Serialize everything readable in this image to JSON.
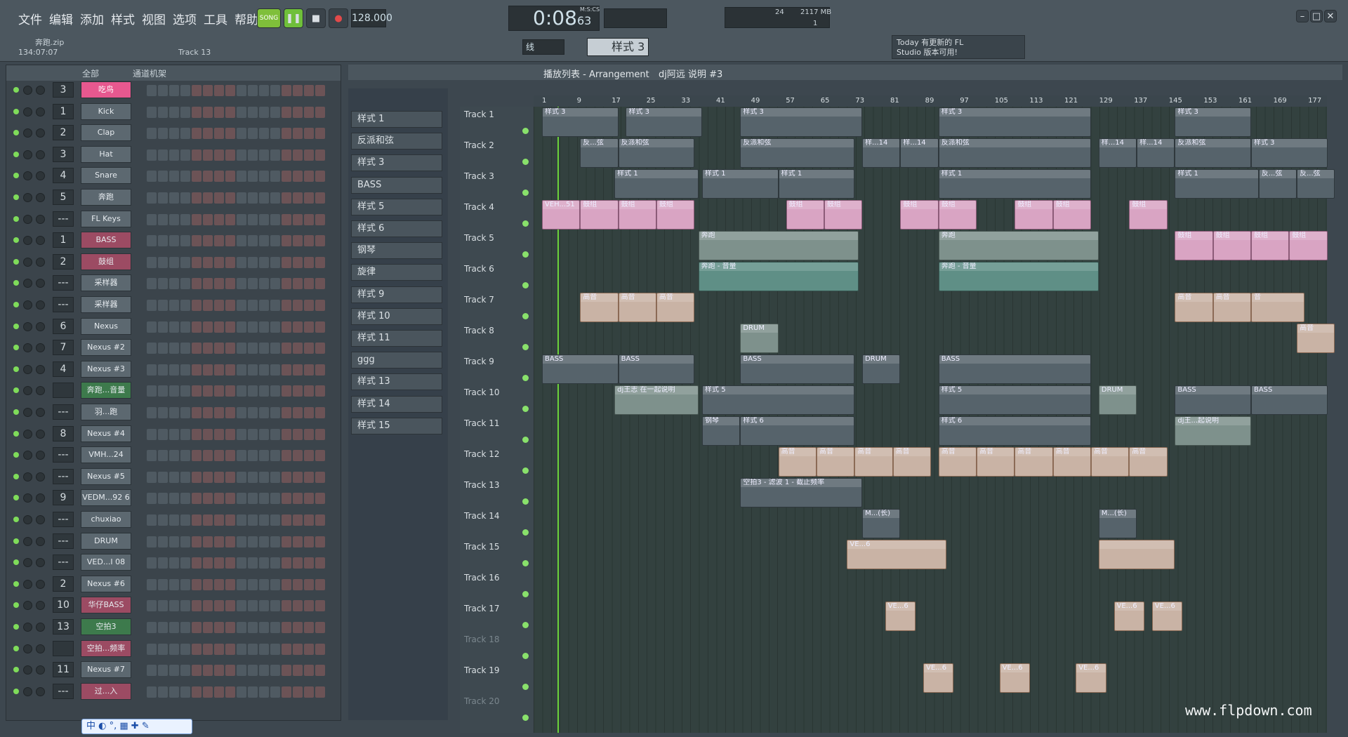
{
  "menu": [
    "文件",
    "编辑",
    "添加",
    "样式",
    "视图",
    "选项",
    "工具",
    "帮助"
  ],
  "transport": {
    "song_label": "SONG",
    "tempo": "128.000",
    "time": "0:08",
    "time_sub": "63",
    "time_unit": "M:S:CS",
    "cpu": "24",
    "memory": "2117 MB",
    "memory_sub": "1"
  },
  "project": {
    "file": "奔跑.zip",
    "position": "134:07:07",
    "track_hint": "Track 13"
  },
  "snap": {
    "mode": "线",
    "pattern": "样式 3"
  },
  "hint": {
    "line1": "Today 有更新的 FL",
    "line2": "Studio 版本可用!"
  },
  "rack": {
    "group": "全部",
    "title": "通道机架",
    "channels": [
      {
        "num": "3",
        "name": "吃鸟",
        "style": "pink"
      },
      {
        "num": "1",
        "name": "Kick",
        "style": ""
      },
      {
        "num": "2",
        "name": "Clap",
        "style": ""
      },
      {
        "num": "3",
        "name": "Hat",
        "style": ""
      },
      {
        "num": "4",
        "name": "Snare",
        "style": ""
      },
      {
        "num": "5",
        "name": "奔跑",
        "style": ""
      },
      {
        "num": "---",
        "name": "FL Keys",
        "style": ""
      },
      {
        "num": "1",
        "name": "BASS",
        "style": "dpink"
      },
      {
        "num": "2",
        "name": "鼓组",
        "style": "dpink"
      },
      {
        "num": "---",
        "name": "采样器",
        "style": ""
      },
      {
        "num": "---",
        "name": "采样器",
        "style": ""
      },
      {
        "num": "6",
        "name": "Nexus",
        "style": ""
      },
      {
        "num": "7",
        "name": "Nexus #2",
        "style": ""
      },
      {
        "num": "4",
        "name": "Nexus #3",
        "style": ""
      },
      {
        "num": "",
        "name": "奔跑...音量",
        "style": "green"
      },
      {
        "num": "---",
        "name": "羽...跑",
        "style": ""
      },
      {
        "num": "8",
        "name": "Nexus #4",
        "style": ""
      },
      {
        "num": "---",
        "name": "VMH...24",
        "style": ""
      },
      {
        "num": "---",
        "name": "Nexus #5",
        "style": ""
      },
      {
        "num": "9",
        "name": "VEDM...92 6",
        "style": ""
      },
      {
        "num": "---",
        "name": "chuxiao",
        "style": ""
      },
      {
        "num": "---",
        "name": "DRUM",
        "style": ""
      },
      {
        "num": "---",
        "name": "VED...I 08",
        "style": ""
      },
      {
        "num": "2",
        "name": "Nexus #6",
        "style": ""
      },
      {
        "num": "10",
        "name": "华仔BASS",
        "style": "dpink"
      },
      {
        "num": "13",
        "name": "空拍3",
        "style": "green"
      },
      {
        "num": "",
        "name": "空拍...频率",
        "style": "dpink"
      },
      {
        "num": "11",
        "name": "Nexus #7",
        "style": ""
      },
      {
        "num": "---",
        "name": "过...入",
        "style": "dpink"
      }
    ]
  },
  "patterns": [
    "样式 1",
    "反派和弦",
    "样式 3",
    "BASS",
    "样式 5",
    "样式 6",
    "钢琴",
    "旋律",
    "样式 9",
    "样式 10",
    "样式 11",
    "ggg",
    "样式 13",
    "样式 14",
    "样式 15"
  ],
  "playlist": {
    "title": "播放列表 - Arrangement",
    "crumb": "dj阿远 说明 #3",
    "ruler": [
      "1",
      "9",
      "17",
      "25",
      "33",
      "41",
      "49",
      "57",
      "65",
      "73",
      "81",
      "89",
      "97",
      "105",
      "113",
      "121",
      "129",
      "137",
      "145",
      "153",
      "161",
      "169",
      "177"
    ],
    "tracks": [
      "Track 1",
      "Track 2",
      "Track 3",
      "Track 4",
      "Track 5",
      "Track 6",
      "Track 7",
      "Track 8",
      "Track 9",
      "Track 10",
      "Track 11",
      "Track 12",
      "Track 13",
      "Track 14",
      "Track 15",
      "Track 16",
      "Track 17",
      "Track 18",
      "Track 19",
      "Track 20"
    ],
    "clips": [
      {
        "t": 0,
        "s": 0,
        "l": 20,
        "label": "样式 3",
        "c": "cg"
      },
      {
        "t": 0,
        "s": 22,
        "l": 20,
        "label": "样式 3",
        "c": "cg"
      },
      {
        "t": 0,
        "s": 52,
        "l": 32,
        "label": "样式 3",
        "c": "cg"
      },
      {
        "t": 0,
        "s": 104,
        "l": 40,
        "label": "样式 3",
        "c": "cg"
      },
      {
        "t": 0,
        "s": 166,
        "l": 20,
        "label": "样式 3",
        "c": "cg"
      },
      {
        "t": 1,
        "s": 10,
        "l": 10,
        "label": "反...弦",
        "c": "cg"
      },
      {
        "t": 1,
        "s": 20,
        "l": 20,
        "label": "反派和弦",
        "c": "cg"
      },
      {
        "t": 1,
        "s": 52,
        "l": 30,
        "label": "反派和弦",
        "c": "cg"
      },
      {
        "t": 1,
        "s": 84,
        "l": 10,
        "label": "样...14",
        "c": "cg"
      },
      {
        "t": 1,
        "s": 94,
        "l": 10,
        "label": "样...14",
        "c": "cg"
      },
      {
        "t": 1,
        "s": 104,
        "l": 40,
        "label": "反派和弦",
        "c": "cg"
      },
      {
        "t": 1,
        "s": 146,
        "l": 10,
        "label": "样...14",
        "c": "cg"
      },
      {
        "t": 1,
        "s": 156,
        "l": 10,
        "label": "样...14",
        "c": "cg"
      },
      {
        "t": 1,
        "s": 166,
        "l": 20,
        "label": "反派和弦",
        "c": "cg"
      },
      {
        "t": 1,
        "s": 186,
        "l": 20,
        "label": "样式 3",
        "c": "cg"
      },
      {
        "t": 2,
        "s": 19,
        "l": 22,
        "label": "样式 1",
        "c": "cg"
      },
      {
        "t": 2,
        "s": 42,
        "l": 20,
        "label": "样式 1",
        "c": "cg"
      },
      {
        "t": 2,
        "s": 62,
        "l": 20,
        "label": "样式 1",
        "c": "cg"
      },
      {
        "t": 2,
        "s": 104,
        "l": 40,
        "label": "样式 1",
        "c": "cg"
      },
      {
        "t": 2,
        "s": 166,
        "l": 22,
        "label": "样式 1",
        "c": "cg"
      },
      {
        "t": 2,
        "s": 188,
        "l": 10,
        "label": "反...弦",
        "c": "cg"
      },
      {
        "t": 2,
        "s": 198,
        "l": 10,
        "label": "反...弦",
        "c": "cg"
      },
      {
        "t": 3,
        "s": 0,
        "l": 10,
        "label": "VEH...51",
        "c": "cp"
      },
      {
        "t": 3,
        "s": 10,
        "l": 10,
        "label": "鼓组",
        "c": "cp"
      },
      {
        "t": 3,
        "s": 20,
        "l": 10,
        "label": "鼓组",
        "c": "cp"
      },
      {
        "t": 3,
        "s": 30,
        "l": 10,
        "label": "鼓组",
        "c": "cp"
      },
      {
        "t": 3,
        "s": 64,
        "l": 10,
        "label": "鼓组",
        "c": "cp"
      },
      {
        "t": 3,
        "s": 74,
        "l": 10,
        "label": "鼓组",
        "c": "cp"
      },
      {
        "t": 3,
        "s": 94,
        "l": 10,
        "label": "鼓组",
        "c": "cp"
      },
      {
        "t": 3,
        "s": 104,
        "l": 10,
        "label": "鼓组",
        "c": "cp"
      },
      {
        "t": 3,
        "s": 124,
        "l": 10,
        "label": "鼓组",
        "c": "cp"
      },
      {
        "t": 3,
        "s": 134,
        "l": 10,
        "label": "鼓组",
        "c": "cp"
      },
      {
        "t": 3,
        "s": 154,
        "l": 10,
        "label": "鼓组",
        "c": "cp"
      },
      {
        "t": 4,
        "s": 41,
        "l": 42,
        "label": "奔跑",
        "c": "cv"
      },
      {
        "t": 4,
        "s": 104,
        "l": 42,
        "label": "奔跑",
        "c": "cv"
      },
      {
        "t": 4,
        "s": 166,
        "l": 10,
        "label": "鼓组",
        "c": "cp"
      },
      {
        "t": 4,
        "s": 176,
        "l": 10,
        "label": "鼓组",
        "c": "cp"
      },
      {
        "t": 4,
        "s": 186,
        "l": 10,
        "label": "鼓组",
        "c": "cp"
      },
      {
        "t": 4,
        "s": 196,
        "l": 10,
        "label": "鼓组",
        "c": "cp"
      },
      {
        "t": 5,
        "s": 41,
        "l": 42,
        "label": "奔跑 - 音量",
        "c": "ct"
      },
      {
        "t": 5,
        "s": 104,
        "l": 42,
        "label": "奔跑 - 音量",
        "c": "ct"
      },
      {
        "t": 6,
        "s": 10,
        "l": 10,
        "label": "高音",
        "c": "co"
      },
      {
        "t": 6,
        "s": 20,
        "l": 10,
        "label": "高音",
        "c": "co"
      },
      {
        "t": 6,
        "s": 30,
        "l": 10,
        "label": "高音",
        "c": "co"
      },
      {
        "t": 6,
        "s": 166,
        "l": 10,
        "label": "高音",
        "c": "co"
      },
      {
        "t": 6,
        "s": 176,
        "l": 10,
        "label": "高音",
        "c": "co"
      },
      {
        "t": 6,
        "s": 186,
        "l": 14,
        "label": "音",
        "c": "co"
      },
      {
        "t": 7,
        "s": 52,
        "l": 10,
        "label": "DRUM",
        "c": "cv"
      },
      {
        "t": 7,
        "s": 198,
        "l": 10,
        "label": "高音",
        "c": "co"
      },
      {
        "t": 8,
        "s": 0,
        "l": 20,
        "label": "BASS",
        "c": "cg"
      },
      {
        "t": 8,
        "s": 20,
        "l": 20,
        "label": "BASS",
        "c": "cg"
      },
      {
        "t": 8,
        "s": 52,
        "l": 30,
        "label": "BASS",
        "c": "cg"
      },
      {
        "t": 8,
        "s": 84,
        "l": 10,
        "label": "DRUM",
        "c": "cg"
      },
      {
        "t": 8,
        "s": 104,
        "l": 40,
        "label": "BASS",
        "c": "cg"
      },
      {
        "t": 9,
        "s": 19,
        "l": 22,
        "label": "dj王志 在一起说明",
        "c": "cv"
      },
      {
        "t": 9,
        "s": 42,
        "l": 40,
        "label": "样式 5",
        "c": "cg"
      },
      {
        "t": 9,
        "s": 104,
        "l": 40,
        "label": "样式 5",
        "c": "cg"
      },
      {
        "t": 9,
        "s": 146,
        "l": 10,
        "label": "DRUM",
        "c": "cv"
      },
      {
        "t": 9,
        "s": 166,
        "l": 20,
        "label": "BASS",
        "c": "cg"
      },
      {
        "t": 9,
        "s": 186,
        "l": 20,
        "label": "BASS",
        "c": "cg"
      },
      {
        "t": 10,
        "s": 42,
        "l": 10,
        "label": "钢琴",
        "c": "cg"
      },
      {
        "t": 10,
        "s": 52,
        "l": 30,
        "label": "样式 6",
        "c": "cg"
      },
      {
        "t": 10,
        "s": 104,
        "l": 40,
        "label": "样式 6",
        "c": "cg"
      },
      {
        "t": 10,
        "s": 166,
        "l": 20,
        "label": "dj王...起说明",
        "c": "cv"
      },
      {
        "t": 11,
        "s": 62,
        "l": 10,
        "label": "高音",
        "c": "co"
      },
      {
        "t": 11,
        "s": 72,
        "l": 10,
        "label": "高音",
        "c": "co"
      },
      {
        "t": 11,
        "s": 82,
        "l": 10,
        "label": "高音",
        "c": "co"
      },
      {
        "t": 11,
        "s": 92,
        "l": 10,
        "label": "高音",
        "c": "co"
      },
      {
        "t": 11,
        "s": 104,
        "l": 10,
        "label": "高音",
        "c": "co"
      },
      {
        "t": 11,
        "s": 114,
        "l": 10,
        "label": "高音",
        "c": "co"
      },
      {
        "t": 11,
        "s": 124,
        "l": 10,
        "label": "高音",
        "c": "co"
      },
      {
        "t": 11,
        "s": 134,
        "l": 10,
        "label": "高音",
        "c": "co"
      },
      {
        "t": 11,
        "s": 144,
        "l": 10,
        "label": "高音",
        "c": "co"
      },
      {
        "t": 11,
        "s": 154,
        "l": 10,
        "label": "高音",
        "c": "co"
      },
      {
        "t": 12,
        "s": 52,
        "l": 32,
        "label": "空拍3 - 滤波 1 - 截止频率",
        "c": "cg"
      },
      {
        "t": 13,
        "s": 84,
        "l": 10,
        "label": "M...(长)",
        "c": "cg"
      },
      {
        "t": 13,
        "s": 146,
        "l": 10,
        "label": "M...(长)",
        "c": "cg"
      },
      {
        "t": 14,
        "s": 80,
        "l": 26,
        "label": "VE...6",
        "c": "co"
      },
      {
        "t": 14,
        "s": 146,
        "l": 20,
        "label": "",
        "c": "co"
      },
      {
        "t": 16,
        "s": 90,
        "l": 8,
        "label": "VE...6",
        "c": "co"
      },
      {
        "t": 16,
        "s": 150,
        "l": 8,
        "label": "VE...6",
        "c": "co"
      },
      {
        "t": 16,
        "s": 160,
        "l": 8,
        "label": "VE...6",
        "c": "co"
      },
      {
        "t": 18,
        "s": 100,
        "l": 8,
        "label": "VE...6",
        "c": "co"
      },
      {
        "t": 18,
        "s": 120,
        "l": 8,
        "label": "VE...6",
        "c": "co"
      },
      {
        "t": 18,
        "s": 140,
        "l": 8,
        "label": "VE...6",
        "c": "co"
      }
    ]
  },
  "watermark": "www.flpdown.com",
  "ime": "中 ◐ °,  ▦ ✚ ✎"
}
